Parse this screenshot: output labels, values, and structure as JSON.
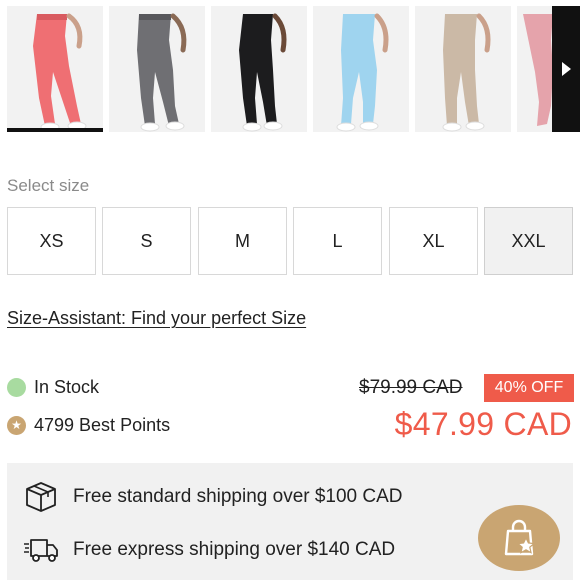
{
  "colors": {
    "accent_sale": "#ef5b4a",
    "in_stock": "#a8dba0",
    "gold": "#c9a572",
    "swatch_colors": [
      "#ef6f73",
      "#6f6f73",
      "#1c1c1e",
      "#9fd4ef",
      "#cbb9a6",
      "#e5a3ab"
    ]
  },
  "swatches": [
    {
      "name": "coral",
      "selected": true
    },
    {
      "name": "grey",
      "selected": false
    },
    {
      "name": "black",
      "selected": false
    },
    {
      "name": "light-blue",
      "selected": false
    },
    {
      "name": "beige",
      "selected": false
    },
    {
      "name": "pink",
      "selected": false
    }
  ],
  "size": {
    "label": "Select size",
    "options": [
      "XS",
      "S",
      "M",
      "L",
      "XL",
      "XXL"
    ],
    "selected": "XXL"
  },
  "assistant": {
    "link": "Size-Assistant: Find your perfect Size"
  },
  "stock": {
    "status": "In Stock"
  },
  "points": {
    "text": "4799 Best Points"
  },
  "price": {
    "original": "$79.99 CAD",
    "discount": "40% OFF",
    "current": "$47.99 CAD"
  },
  "shipping": {
    "standard": "Free standard shipping over $100 CAD",
    "express": "Free express shipping over $140 CAD"
  },
  "icons": {
    "next": "chevron-right-icon",
    "box": "box-icon",
    "truck": "truck-icon",
    "rewards": "shopping-bag-star-icon",
    "star": "star-icon"
  }
}
